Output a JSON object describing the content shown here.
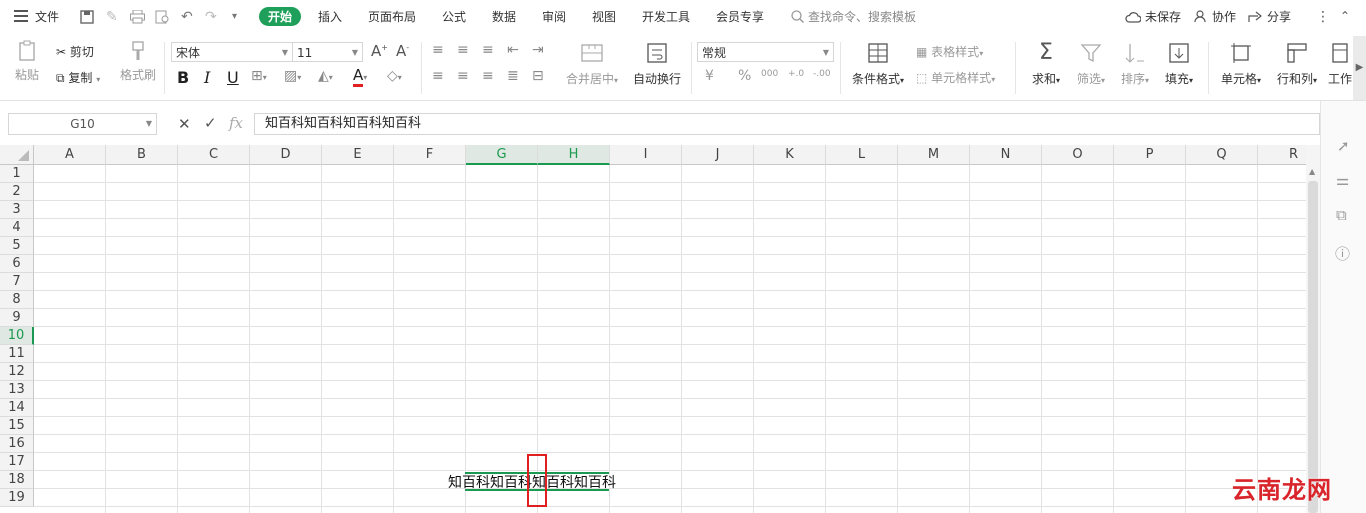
{
  "topbar": {
    "file_menu": "文件",
    "tabs": [
      "开始",
      "插入",
      "页面布局",
      "公式",
      "数据",
      "审阅",
      "视图",
      "开发工具",
      "会员专享"
    ],
    "search_placeholder": "查找命令、搜索模板",
    "unsaved": "未保存",
    "collab": "协作",
    "share": "分享"
  },
  "ribbon": {
    "paste": "粘贴",
    "cut": "剪切",
    "copy": "复制",
    "format_painter": "格式刷",
    "font_name": "宋体",
    "font_size": "11",
    "bold": "B",
    "italic": "I",
    "underline": "U",
    "font_color_letter": "A",
    "merge_center": "合并居中",
    "wrap_text": "自动换行",
    "number_format": "常规",
    "currency_symbol": "¥",
    "percent_symbol": "%",
    "thousands_symbol": "000",
    "increase_decimal": "+.0",
    "decrease_decimal": "-.00",
    "conditional_format": "条件格式",
    "table_style": "表格样式",
    "cell_style": "单元格样式",
    "sum": "求和",
    "filter": "筛选",
    "sort": "排序",
    "fill": "填充",
    "cell": "单元格",
    "row_col": "行和列",
    "worksheet": "工作"
  },
  "formula_bar": {
    "cell_ref": "G10",
    "content": "知百科知百科知百科知百科"
  },
  "grid": {
    "columns": [
      "A",
      "B",
      "C",
      "D",
      "E",
      "F",
      "G",
      "H",
      "I",
      "J",
      "K",
      "L",
      "M",
      "N",
      "O",
      "P",
      "Q",
      "R"
    ],
    "rows": [
      "1",
      "2",
      "3",
      "4",
      "5",
      "6",
      "7",
      "8",
      "9",
      "10",
      "11",
      "12",
      "13",
      "14",
      "15",
      "16",
      "17",
      "18",
      "19"
    ],
    "selected_row": "10",
    "selected_columns": [
      "G",
      "H"
    ],
    "cell_text": "知百科知百科知百科知百科"
  },
  "watermark": "云南龙网",
  "colors": {
    "accent": "#1fa05a",
    "highlight": "#e02020",
    "watermark": "#d8242a"
  }
}
